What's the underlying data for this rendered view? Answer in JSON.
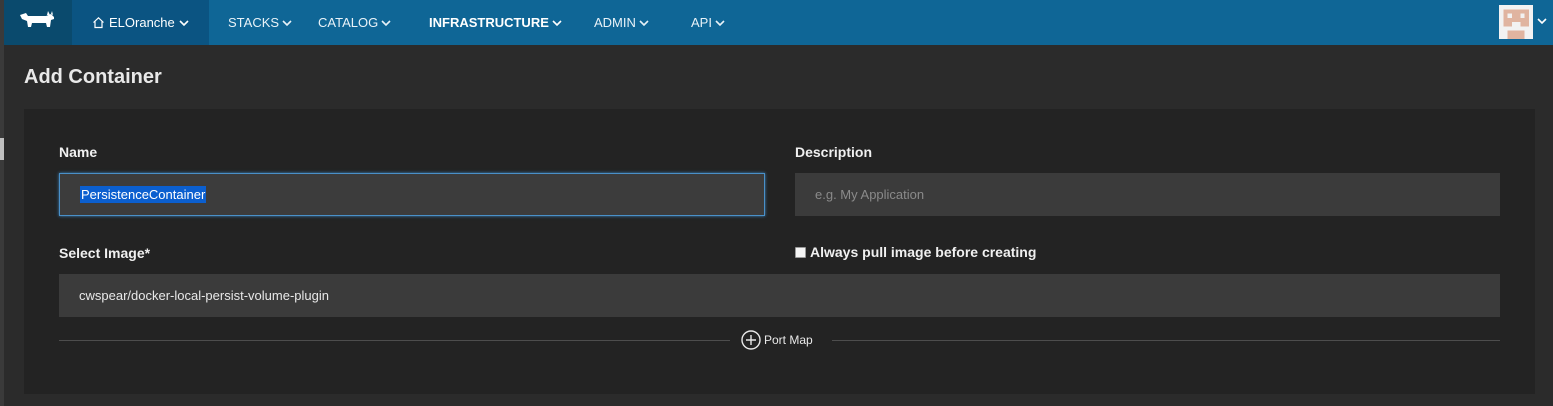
{
  "nav": {
    "environment": "ELOranche",
    "items": [
      {
        "label": "STACKS"
      },
      {
        "label": "CATALOG"
      },
      {
        "label": "INFRASTRUCTURE"
      },
      {
        "label": "ADMIN"
      },
      {
        "label": "API"
      }
    ],
    "brand_icon": "cow-logo-icon",
    "avatar_icon": "user-avatar-icon"
  },
  "page": {
    "title": "Add Container"
  },
  "form": {
    "name_label": "Name",
    "name_value": "PersistenceContainer",
    "description_label": "Description",
    "description_placeholder": "e.g. My Application",
    "image_label": "Select Image*",
    "image_value": "cwspear/docker-local-persist-volume-plugin",
    "always_pull_label": "Always pull image before creating",
    "always_pull_checked": false,
    "port_map_label": "Port Map"
  },
  "colors": {
    "nav_bg": "#0f6696",
    "brand_bg": "#0a4a6d",
    "env_bg": "#0b5482",
    "page_bg": "#2b2b2b",
    "panel_bg": "#232323",
    "input_bg": "#3b3b3b",
    "focus_border": "#4a90c8",
    "selection": "#0b5fcf"
  }
}
